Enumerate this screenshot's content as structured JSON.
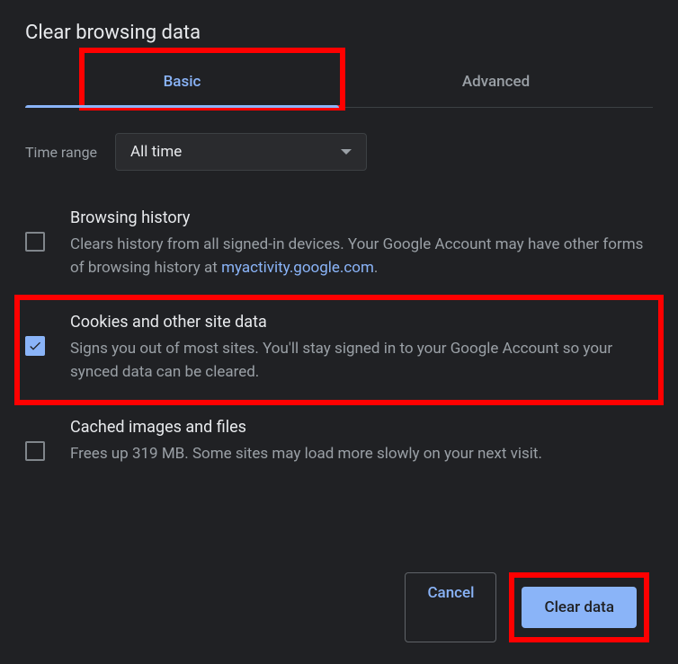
{
  "dialog": {
    "title": "Clear browsing data"
  },
  "tabs": {
    "basic": "Basic",
    "advanced": "Advanced"
  },
  "timeRange": {
    "label": "Time range",
    "value": "All time"
  },
  "options": {
    "browsingHistory": {
      "title": "Browsing history",
      "desc_prefix": "Clears history from all signed-in devices. Your Google Account may have other forms of browsing history at ",
      "link_text": "myactivity.google.com",
      "desc_suffix": "."
    },
    "cookies": {
      "title": "Cookies and other site data",
      "desc": "Signs you out of most sites. You'll stay signed in to your Google Account so your synced data can be cleared."
    },
    "cached": {
      "title": "Cached images and files",
      "desc": "Frees up 319 MB. Some sites may load more slowly on your next visit."
    }
  },
  "buttons": {
    "cancel": "Cancel",
    "clearData": "Clear data"
  }
}
